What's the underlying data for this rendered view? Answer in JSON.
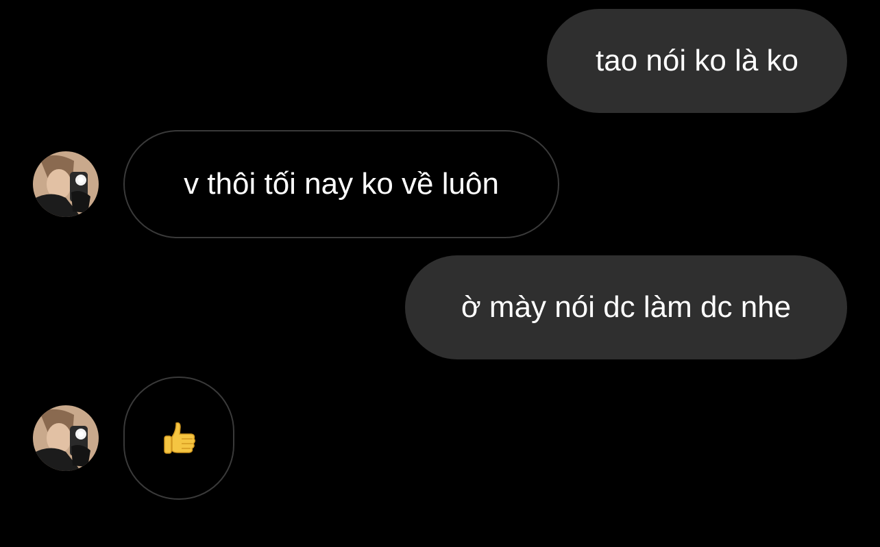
{
  "conversation": {
    "messages": [
      {
        "sender": "me",
        "text": "tao nói ko là ko"
      },
      {
        "sender": "contact",
        "text": "v thôi tối nay ko về luôn"
      },
      {
        "sender": "me",
        "text": "ờ mày nói dc làm dc nhe"
      },
      {
        "sender": "contact",
        "icon": "thumbs-up-icon"
      }
    ]
  },
  "colors": {
    "background": "#000000",
    "sent_bubble": "#2f2f2f",
    "received_border": "#3a3a3a",
    "text": "#ffffff"
  }
}
